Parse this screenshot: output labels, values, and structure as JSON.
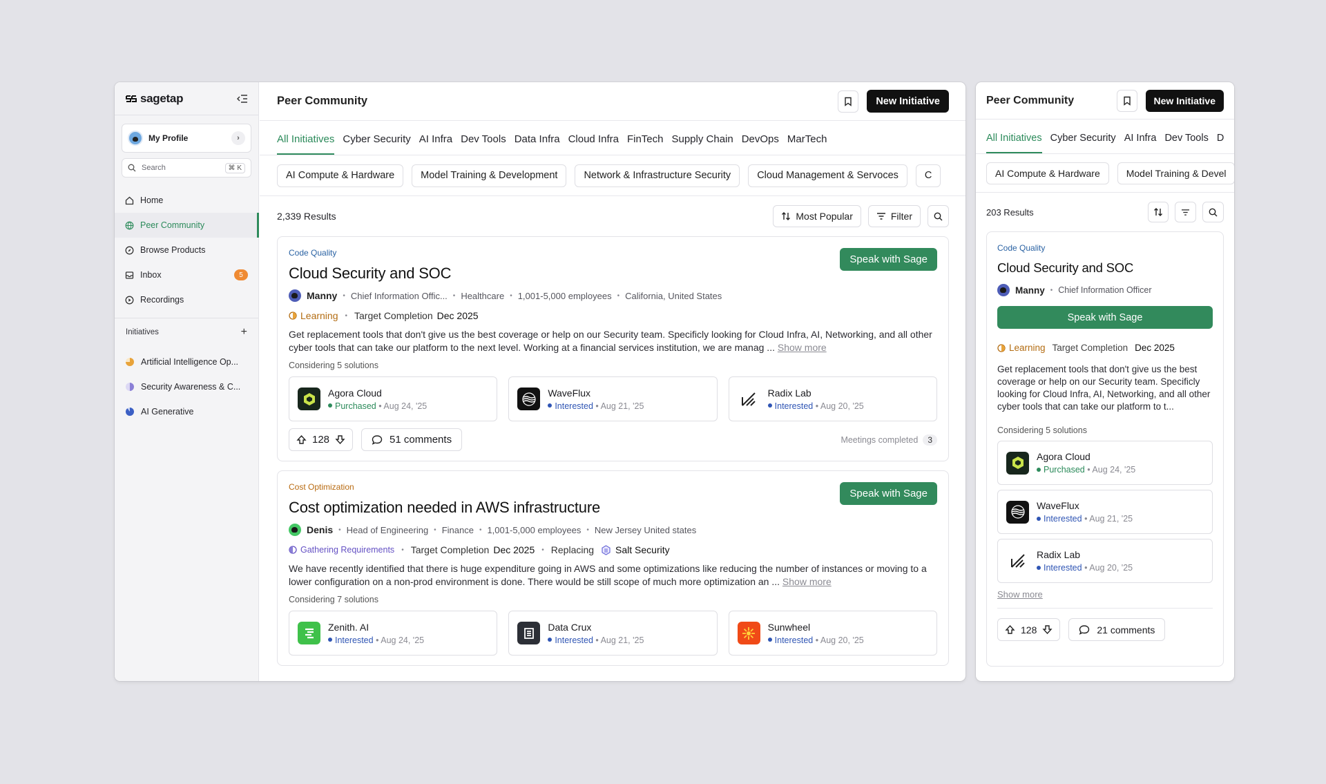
{
  "app": {
    "logo_text": "sagetap"
  },
  "sidebar": {
    "profile_label": "My Profile",
    "search_placeholder": "Search",
    "search_shortcut": "⌘ K",
    "nav": [
      {
        "label": "Home",
        "icon": "home-icon"
      },
      {
        "label": "Peer Community",
        "icon": "globe-icon",
        "active": true
      },
      {
        "label": "Browse Products",
        "icon": "compass-icon"
      },
      {
        "label": "Inbox",
        "icon": "inbox-icon",
        "badge": "5"
      },
      {
        "label": "Recordings",
        "icon": "play-circle-icon"
      }
    ],
    "initiatives_header": "Initiatives",
    "initiatives": [
      {
        "label": "Artificial Intelligence Op...",
        "color": "#e8a33a"
      },
      {
        "label": "Security Awareness & C...",
        "color": "#8a7fd6"
      },
      {
        "label": "AI Generative",
        "color": "#3b5fc4"
      }
    ]
  },
  "header": {
    "title": "Peer Community",
    "new_initiative": "New Initiative"
  },
  "tabs": [
    "All Initiatives",
    "Cyber Security",
    "AI Infra",
    "Dev Tools",
    "Data Infra",
    "Cloud Infra",
    "FinTech",
    "Supply Chain",
    "DevOps",
    "MarTech"
  ],
  "chips": [
    "AI Compute & Hardware",
    "Model Training & Development",
    "Network & Infrastructure Security",
    "Cloud Management & Servoces",
    "C"
  ],
  "toolbar": {
    "results": "2,339 Results",
    "sort_label": "Most Popular",
    "filter_label": "Filter"
  },
  "cards": [
    {
      "category": "Code Quality",
      "title": "Cloud Security and SOC",
      "speak": "Speak with Sage",
      "author": "Manny",
      "role": "Chief Information Offic...",
      "industry": "Healthcare",
      "size": "1,001-5,000 employees",
      "location": "California, United States",
      "status": "Learning",
      "target_label": "Target Completion",
      "target_date": "Dec 2025",
      "description": "Get replacement tools that don't give us the best coverage or help on our Security team. Specificly looking for Cloud Infra, AI, Networking, and all other cyber tools that can take our platform to the next level. Working at a financial services institution, we are manag ...",
      "show_more": "Show more",
      "considering": "Considering 5 solutions",
      "solutions": [
        {
          "name": "Agora Cloud",
          "status": "Purchased",
          "date": "• Aug 24, '25"
        },
        {
          "name": "WaveFlux",
          "status": "Interested",
          "date": "• Aug 21, '25"
        },
        {
          "name": "Radix Lab",
          "status": "Interested",
          "date": "• Aug 20, '25"
        }
      ],
      "votes": "128",
      "comments": "51 comments",
      "meetings_label": "Meetings completed",
      "meetings_count": "3"
    },
    {
      "category": "Cost Optimization",
      "title": "Cost optimization needed in AWS infrastructure",
      "speak": "Speak with Sage",
      "author": "Denis",
      "role": "Head of Engineering",
      "industry": "Finance",
      "size": "1,001-5,000 employees",
      "location": "New Jersey United states",
      "status": "Gathering Requirements",
      "target_label": "Target Completion",
      "target_date": "Dec 2025",
      "replacing_label": "Replacing",
      "replacing": "Salt Security",
      "description": "We have recently identified that there is huge expenditure going in AWS and some optimizations like reducing the number of instances or moving to a lower configuration on a non-prod environment is done. There would be still scope of much more optimization an ...",
      "show_more": "Show more",
      "considering": "Considering 7 solutions",
      "solutions": [
        {
          "name": "Zenith. AI",
          "status": "Interested",
          "date": "• Aug 24, '25"
        },
        {
          "name": "Data Crux",
          "status": "Interested",
          "date": "• Aug 21, '25"
        },
        {
          "name": "Sunwheel",
          "status": "Interested",
          "date": "• Aug 20, '25"
        }
      ]
    }
  ],
  "side": {
    "title": "Peer Community",
    "new_initiative": "New Initiative",
    "tabs": [
      "All Initiatives",
      "Cyber Security",
      "AI Infra",
      "Dev Tools",
      "D"
    ],
    "chips": [
      "AI Compute & Hardware",
      "Model Training & Devel"
    ],
    "results": "203 Results",
    "card": {
      "category": "Code Quality",
      "title": "Cloud Security and SOC",
      "author": "Manny",
      "role": "Chief Information Officer",
      "speak": "Speak with Sage",
      "status": "Learning",
      "target_label": "Target Completion",
      "target_date": "Dec 2025",
      "description": "Get replacement tools that don't give us the best coverage or help on our Security team. Specificly looking for Cloud Infra, AI, Networking, and all other cyber tools that can take our platform to t...",
      "considering": "Considering 5 solutions",
      "solutions": [
        {
          "name": "Agora Cloud",
          "status": "Purchased",
          "date": "• Aug 24, '25"
        },
        {
          "name": "WaveFlux",
          "status": "Interested",
          "date": "• Aug 21, '25"
        },
        {
          "name": "Radix Lab",
          "status": "Interested",
          "date": "• Aug 20, '25"
        }
      ],
      "show_more": "Show more",
      "votes": "128",
      "comments": "21 comments"
    }
  },
  "colors": {
    "accent": "#2e8b5c",
    "dark_button": "#111111",
    "badge": "#ef8a33"
  }
}
